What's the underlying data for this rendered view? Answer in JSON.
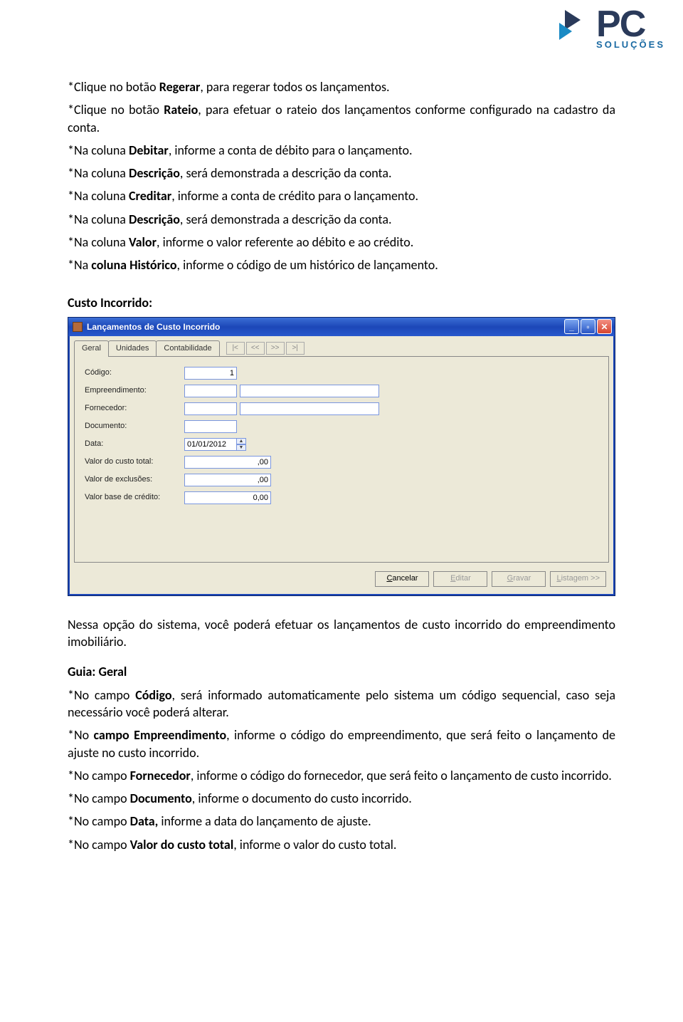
{
  "logo": {
    "brand": "PC",
    "tag": "SOLUÇÕES"
  },
  "doc": {
    "p1_a": "*Clique no botão ",
    "p1_b": "Regerar",
    "p1_c": ", para regerar todos os lançamentos.",
    "p2_a": "*Clique no botão ",
    "p2_b": "Rateio",
    "p2_c": ", para efetuar o rateio dos lançamentos conforme configurado na cadastro da conta.",
    "p3_a": "*Na coluna ",
    "p3_b": "Debitar",
    "p3_c": ", informe a conta de débito para o lançamento.",
    "p4_a": "*Na coluna ",
    "p4_b": "Descrição",
    "p4_c": ", será demonstrada a descrição da conta.",
    "p5_a": "*Na coluna ",
    "p5_b": "Creditar",
    "p5_c": ", informe a conta de crédito para o lançamento.",
    "p6_a": "*Na coluna ",
    "p6_b": "Descrição",
    "p6_c": ", será demonstrada a descrição da conta.",
    "p7_a": "*Na coluna ",
    "p7_b": "Valor",
    "p7_c": ", informe o valor referente ao débito e ao crédito.",
    "p8_a": "*Na ",
    "p8_b": "coluna Histórico",
    "p8_c": ", informe o código de um histórico de lançamento.",
    "h_custo": "Custo Incorrido:",
    "p_after": "Nessa opção do sistema, você poderá efetuar os lançamentos de custo incorrido do empreendimento imobiliário.",
    "h_guia": "Guia: Geral",
    "g1_a": "*No campo ",
    "g1_b": "Código",
    "g1_c": ", será informado automaticamente pelo sistema um código sequencial, caso seja necessário você poderá alterar.",
    "g2_a": "*No  ",
    "g2_b": "campo Empreendimento",
    "g2_c": ", informe o código do empreendimento, que será feito o lançamento de ajuste no custo incorrido.",
    "g3_a": "*No campo ",
    "g3_b": "Fornecedor",
    "g3_c": ", informe o código do fornecedor, que será feito o lançamento de custo incorrido.",
    "g4_a": "*No campo ",
    "g4_b": "Documento",
    "g4_c": ", informe o documento do custo incorrido.",
    "g5_a": "*No campo ",
    "g5_b": "Data,",
    "g5_c": " informe a data do lançamento de ajuste.",
    "g6_a": "*No campo ",
    "g6_b": "Valor do custo total",
    "g6_c": ", informe o valor do custo total."
  },
  "win": {
    "title": "Lançamentos de Custo Incorrido",
    "tabs": [
      "Geral",
      "Unidades",
      "Contabilidade"
    ],
    "nav": [
      "|<",
      "<<",
      ">>",
      ">|"
    ],
    "fields": {
      "codigo_l": "Código:",
      "codigo_v": "1",
      "empreend_l": "Empreendimento:",
      "fornec_l": "Fornecedor:",
      "doc_l": "Documento:",
      "data_l": "Data:",
      "data_v": "01/01/2012",
      "vct_l": "Valor do custo total:",
      "vct_v": ",00",
      "vex_l": "Valor de exclusões:",
      "vex_v": ",00",
      "vbc_l": "Valor base de crédito:",
      "vbc_v": "0,00"
    },
    "buttons": {
      "cancelar": "Cancelar",
      "editar": "Editar",
      "gravar": "Gravar",
      "listagem": "Listagem >>"
    }
  }
}
